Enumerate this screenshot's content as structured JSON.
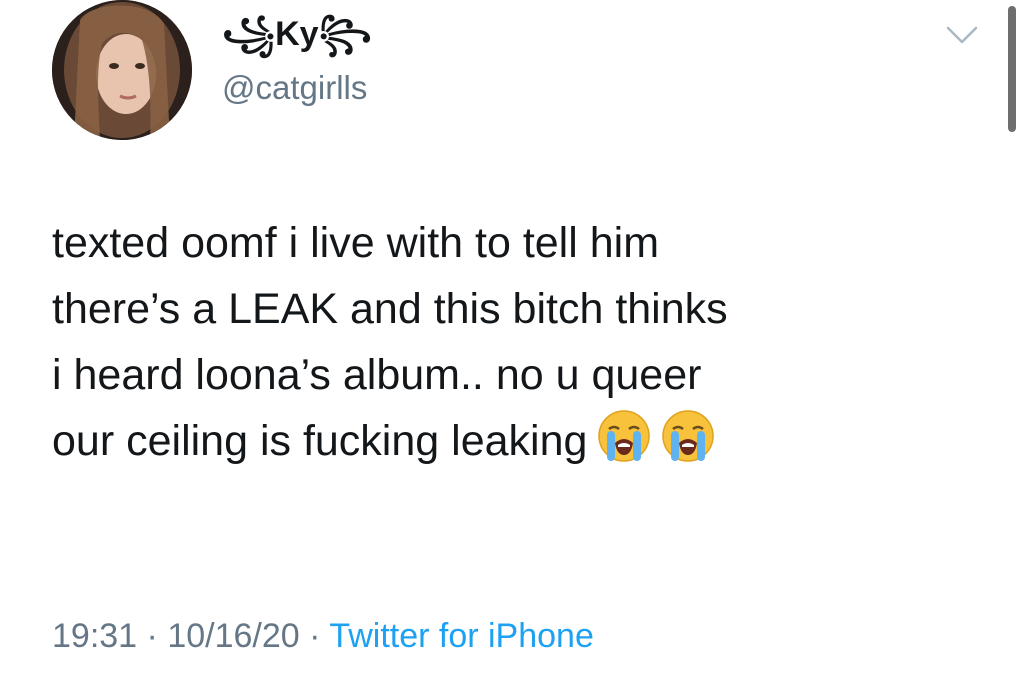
{
  "tweet": {
    "display_name": "꧁Ky꧂",
    "handle": "@catgirlls",
    "text_lines": [
      "texted oomf i live with to tell him",
      "there’s a LEAK and this bitch thinks",
      "i heard loona’s album.. no u queer",
      "our ceiling is fucking leaking"
    ],
    "emoji": [
      "loudly-crying-face",
      "loudly-crying-face"
    ],
    "time": "19:31",
    "date": "10/16/20",
    "separator": "·",
    "source": "Twitter for iPhone"
  },
  "colors": {
    "text": "#14171a",
    "secondary": "#657786",
    "link": "#1da1f2"
  }
}
